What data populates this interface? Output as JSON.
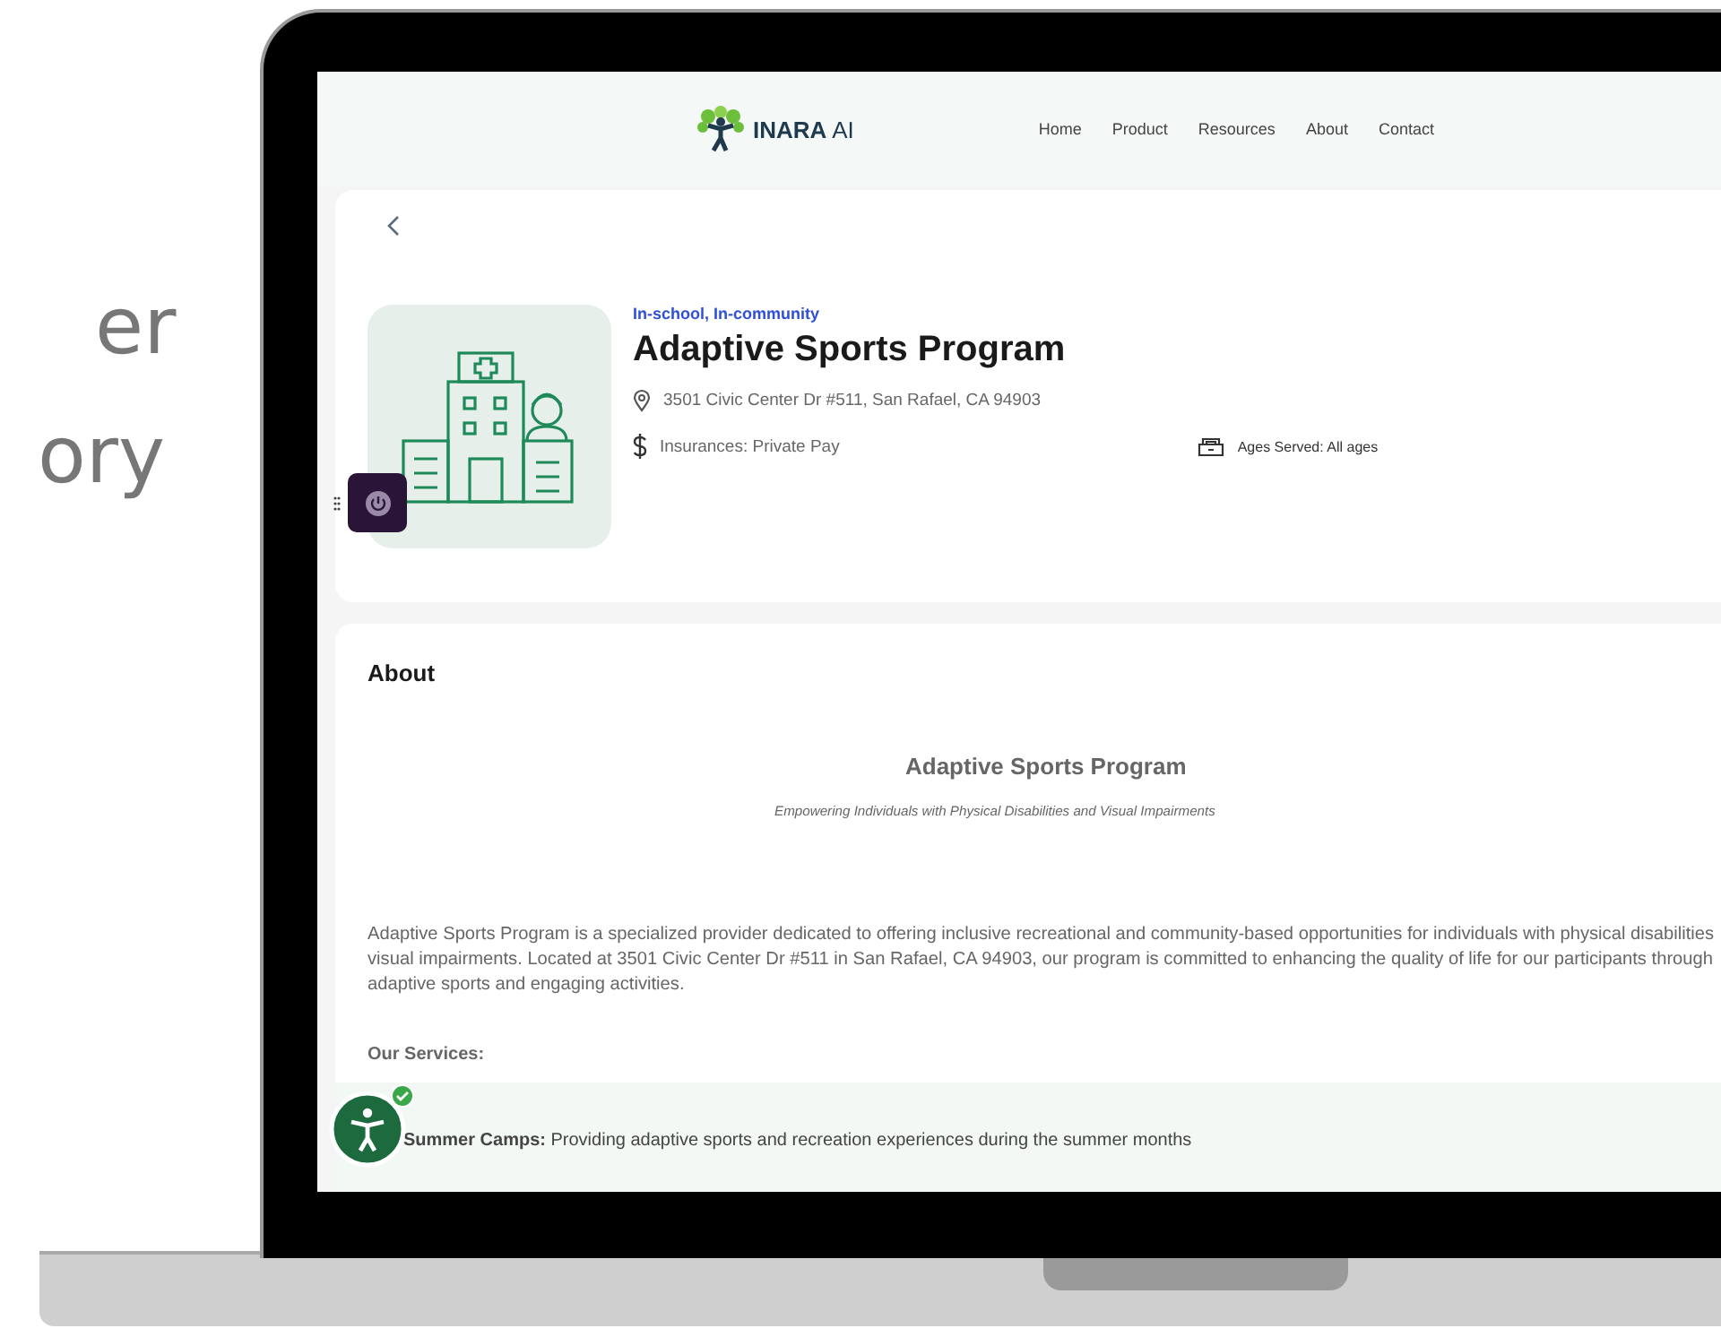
{
  "side_text": [
    "er",
    "ory"
  ],
  "site": {
    "logo": "**INARA** AI",
    "nav": [
      "Home",
      "Product",
      "Resources",
      "About",
      "Contact"
    ]
  },
  "provider": {
    "category": "In-school, In-community",
    "name": "Adaptive Sports Program",
    "address": "3501 Civic Center Dr #511, San Rafael, CA 94903",
    "insurances": "Insurances: Private Pay",
    "ages": "Ages Served: All ages"
  },
  "about": {
    "heading": "About",
    "title": "Adaptive Sports Program",
    "subtitle": "Empowering Individuals with Physical Disabilities and Visual Impairments",
    "paragraph_lines": [
      "Adaptive Sports Program is a specialized provider dedicated to offering inclusive recreational and community-based opportunities for individuals with physical disabilities",
      "visual impairments. Located at 3501 Civic Center Dr #511 in San Rafael, CA 94903, our program is committed to enhancing the quality of life for our participants through",
      "adaptive sports and engaging activities."
    ],
    "services_heading": "Our Services:",
    "services": [
      "**Summer Camps:** Providing adaptive sports and recreation experiences during the summer months"
    ]
  },
  "accessibility_widget": {
    "active": true
  }
}
